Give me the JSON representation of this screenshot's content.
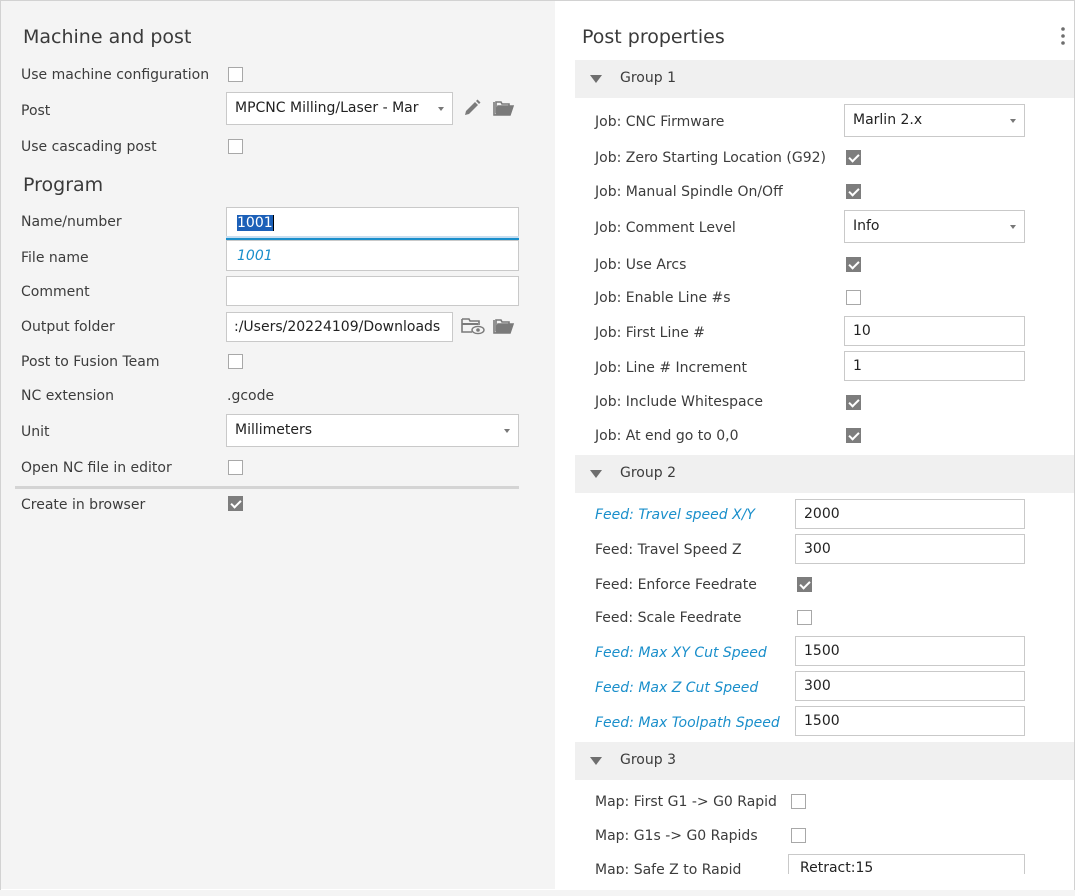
{
  "machine": {
    "title": "Machine and post",
    "use_machine_config_label": "Use machine configuration",
    "use_machine_config_checked": false,
    "post_label": "Post",
    "post_value": "MPCNC Milling/Laser - Mar",
    "use_cascading_label": "Use cascading post",
    "use_cascading_checked": false
  },
  "program": {
    "title": "Program",
    "name_label": "Name/number",
    "name_value": "1001",
    "autocomplete_value": "1001",
    "file_name_label": "File name",
    "comment_label": "Comment",
    "comment_value": "",
    "output_folder_label": "Output folder",
    "output_folder_value": ":/Users/20224109/Downloads",
    "post_fusion_label": "Post to Fusion Team",
    "post_fusion_checked": false,
    "nc_ext_label": "NC extension",
    "nc_ext_value": ".gcode",
    "unit_label": "Unit",
    "unit_value": "Millimeters",
    "open_nc_label": "Open NC file in editor",
    "open_nc_checked": false,
    "create_browser_label": "Create in browser",
    "create_browser_checked": true
  },
  "post_properties": {
    "title": "Post properties",
    "groups": [
      {
        "name": "Group 1",
        "props": [
          {
            "label": "Job: CNC Firmware",
            "type": "select",
            "value": "Marlin 2.x"
          },
          {
            "label": "Job: Zero Starting Location (G92)",
            "type": "check",
            "checked": true
          },
          {
            "label": "Job: Manual Spindle On/Off",
            "type": "check",
            "checked": true
          },
          {
            "label": "Job: Comment Level",
            "type": "select",
            "value": "Info"
          },
          {
            "label": "Job: Use Arcs",
            "type": "check",
            "checked": true
          },
          {
            "label": "Job: Enable Line #s",
            "type": "check",
            "checked": false
          },
          {
            "label": "Job: First Line #",
            "type": "input",
            "value": "10"
          },
          {
            "label": "Job: Line # Increment",
            "type": "input",
            "value": "1"
          },
          {
            "label": "Job: Include Whitespace",
            "type": "check",
            "checked": true
          },
          {
            "label": "Job: At end go to 0,0",
            "type": "check",
            "checked": true
          }
        ]
      },
      {
        "name": "Group 2",
        "props": [
          {
            "label": "Feed: Travel speed X/Y",
            "type": "input",
            "value": "2000",
            "modified": true
          },
          {
            "label": "Feed: Travel Speed Z",
            "type": "input",
            "value": "300"
          },
          {
            "label": "Feed: Enforce Feedrate",
            "type": "check",
            "checked": true
          },
          {
            "label": "Feed: Scale Feedrate",
            "type": "check",
            "checked": false
          },
          {
            "label": "Feed: Max XY Cut Speed",
            "type": "input",
            "value": "1500",
            "modified": true
          },
          {
            "label": "Feed: Max Z Cut Speed",
            "type": "input",
            "value": "300",
            "modified": true
          },
          {
            "label": "Feed: Max Toolpath Speed",
            "type": "input",
            "value": "1500",
            "modified": true
          }
        ]
      },
      {
        "name": "Group 3",
        "props": [
          {
            "label": "Map: First G1 -> G0 Rapid",
            "type": "check",
            "checked": false
          },
          {
            "label": "Map: G1s -> G0 Rapids",
            "type": "check",
            "checked": false
          },
          {
            "label": "Map: Safe Z to Rapid",
            "type": "input",
            "value": "Retract:15"
          }
        ]
      }
    ]
  },
  "icons": [
    "edit-pencil-icon",
    "folder-open-icon",
    "folder-preview-icon",
    "more-vertical-icon",
    "collapse-triangle-icon",
    "dropdown-caret-icon",
    "checkmark-icon"
  ],
  "colors": {
    "modified_label": "#1a8fcb",
    "checked_box": "#7d7d7d",
    "selection": "#1c60b8",
    "left_bg": "#f4f4f4",
    "group_header_bg": "#f0f0f0"
  }
}
